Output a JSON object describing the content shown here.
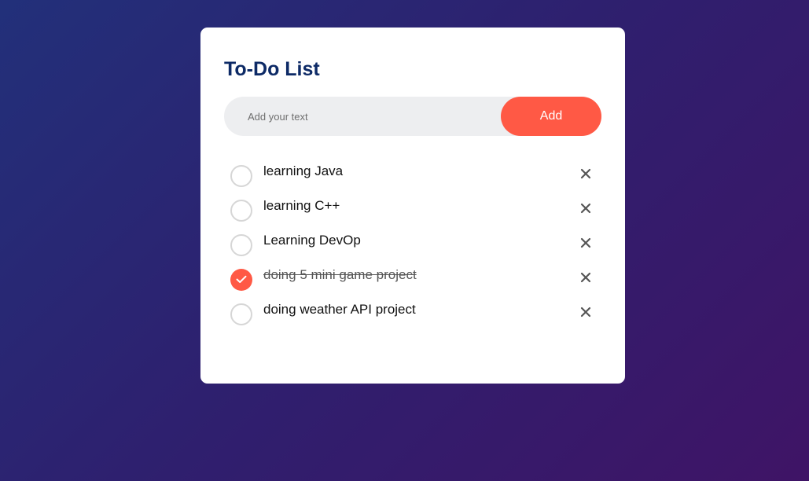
{
  "app": {
    "title": "To-Do List"
  },
  "input": {
    "placeholder": "Add your text",
    "value": ""
  },
  "add_button": {
    "label": "Add"
  },
  "colors": {
    "accent": "#ff5945",
    "title": "#0d2a66",
    "input_bg": "#edeef0"
  },
  "tasks": [
    {
      "label": "learning Java",
      "done": false,
      "check_icon": "circle-icon",
      "delete_icon": "close-icon"
    },
    {
      "label": "learning C++",
      "done": false,
      "check_icon": "circle-icon",
      "delete_icon": "close-icon"
    },
    {
      "label": "Learning DevOp",
      "done": false,
      "check_icon": "circle-icon",
      "delete_icon": "close-icon"
    },
    {
      "label": "doing 5 mini game project",
      "done": true,
      "check_icon": "checkmark-icon",
      "delete_icon": "close-icon"
    },
    {
      "label": "doing weather API project",
      "done": false,
      "check_icon": "circle-icon",
      "delete_icon": "close-icon"
    }
  ]
}
